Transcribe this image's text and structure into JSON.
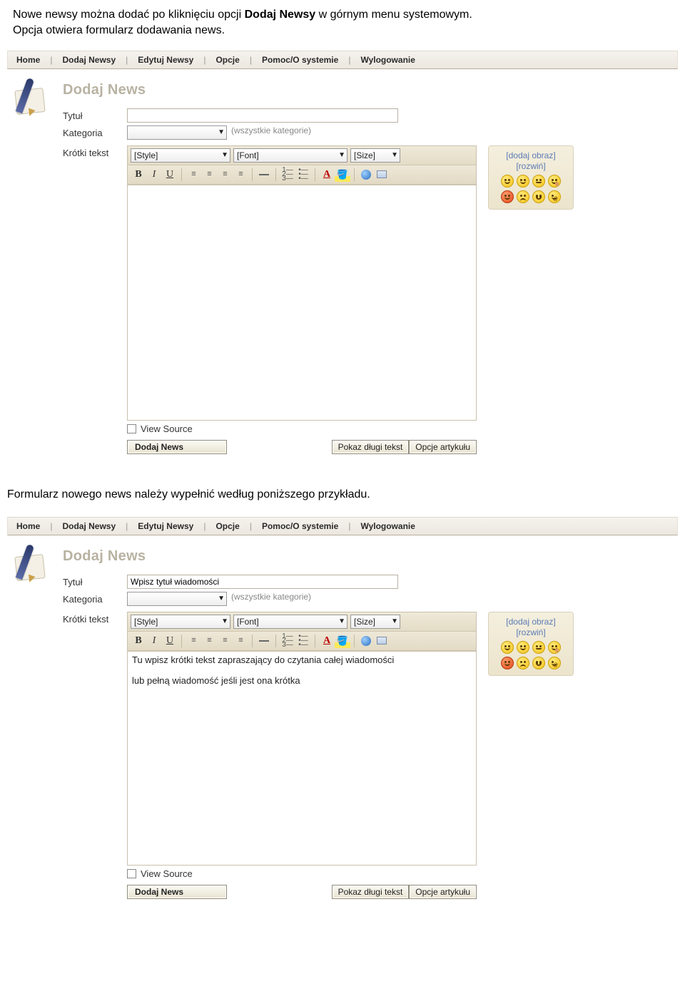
{
  "doc": {
    "intro_part1": "Nowe newsy można dodać po kliknięciu opcji ",
    "intro_bold": "Dodaj Newsy",
    "intro_part2": " w górnym menu systemowym.",
    "intro_line2": "Opcja otwiera formularz dodawania news.",
    "mid_text": "Formularz nowego news należy wypełnić według poniższego przykładu."
  },
  "menu": {
    "items": [
      "Home",
      "Dodaj Newsy",
      "Edytuj Newsy",
      "Opcje",
      "Pomoc/O systemie",
      "Wylogowanie"
    ]
  },
  "form": {
    "heading": "Dodaj News",
    "labels": {
      "title": "Tytuł",
      "category": "Kategoria",
      "short_text": "Krótki tekst"
    },
    "title_value_1": "",
    "title_value_2": "Wpisz tytuł wiadomości",
    "category_note": "(wszystkie kategorie)",
    "editor": {
      "style": "[Style]",
      "font": "[Font]",
      "size": "[Size]",
      "body_1": "",
      "body_2_l1": "Tu wpisz krótki tekst zapraszający do czytania całej wiadomości",
      "body_2_l2": "lub pełną wiadomość jeśli jest ona krótka"
    },
    "view_source": "View Source",
    "buttons": {
      "submit": "Dodaj News",
      "long": "Pokaz długi tekst",
      "opts": "Opcje artykułu"
    }
  },
  "sidebox": {
    "add_image": "[dodaj obraz]",
    "expand": "[rozwiń]"
  }
}
